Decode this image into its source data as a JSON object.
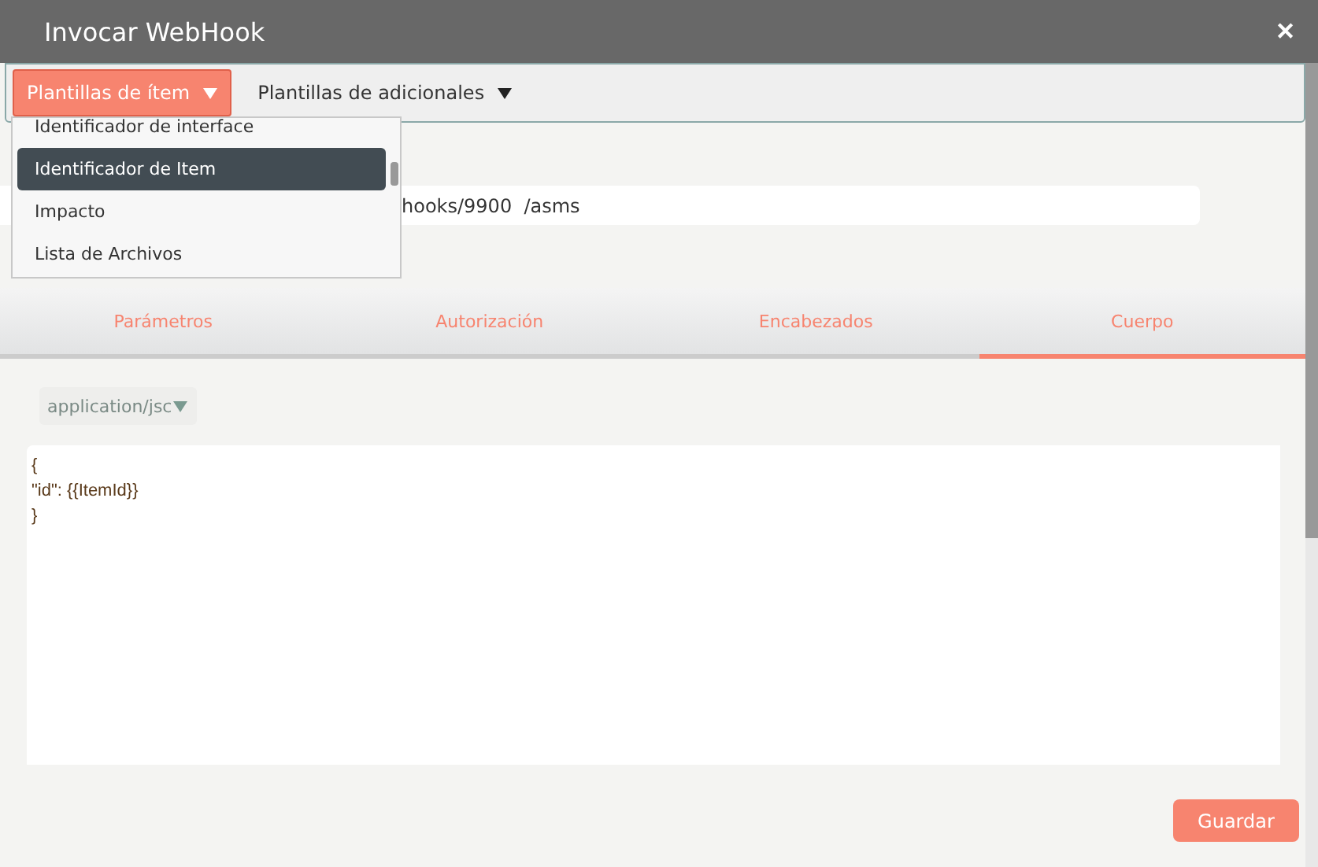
{
  "window": {
    "title": "Invocar WebHook",
    "close": "✕"
  },
  "toolbar": [
    {
      "label": "Plantillas de ítem",
      "selected": true
    },
    {
      "label": "Plantillas de adicionales",
      "selected": false
    }
  ],
  "dropdown": {
    "items": [
      {
        "label": "Identificador de interface",
        "selected": false
      },
      {
        "label": "Identificador de Item",
        "selected": true
      },
      {
        "label": "Impacto",
        "selected": false
      },
      {
        "label": "Lista de Archivos",
        "selected": false
      }
    ]
  },
  "url": {
    "value": "hooks/9900  /asms"
  },
  "tabs": [
    {
      "label": "Parámetros",
      "selected": false
    },
    {
      "label": "Autorización",
      "selected": false
    },
    {
      "label": "Encabezados",
      "selected": false
    },
    {
      "label": "Cuerpo",
      "selected": true
    }
  ],
  "content_type": "application/jsc",
  "body": {
    "lines": [
      "{",
      "\"id\": {{ItemId}}",
      "}"
    ]
  },
  "save_button": "Guardar"
}
